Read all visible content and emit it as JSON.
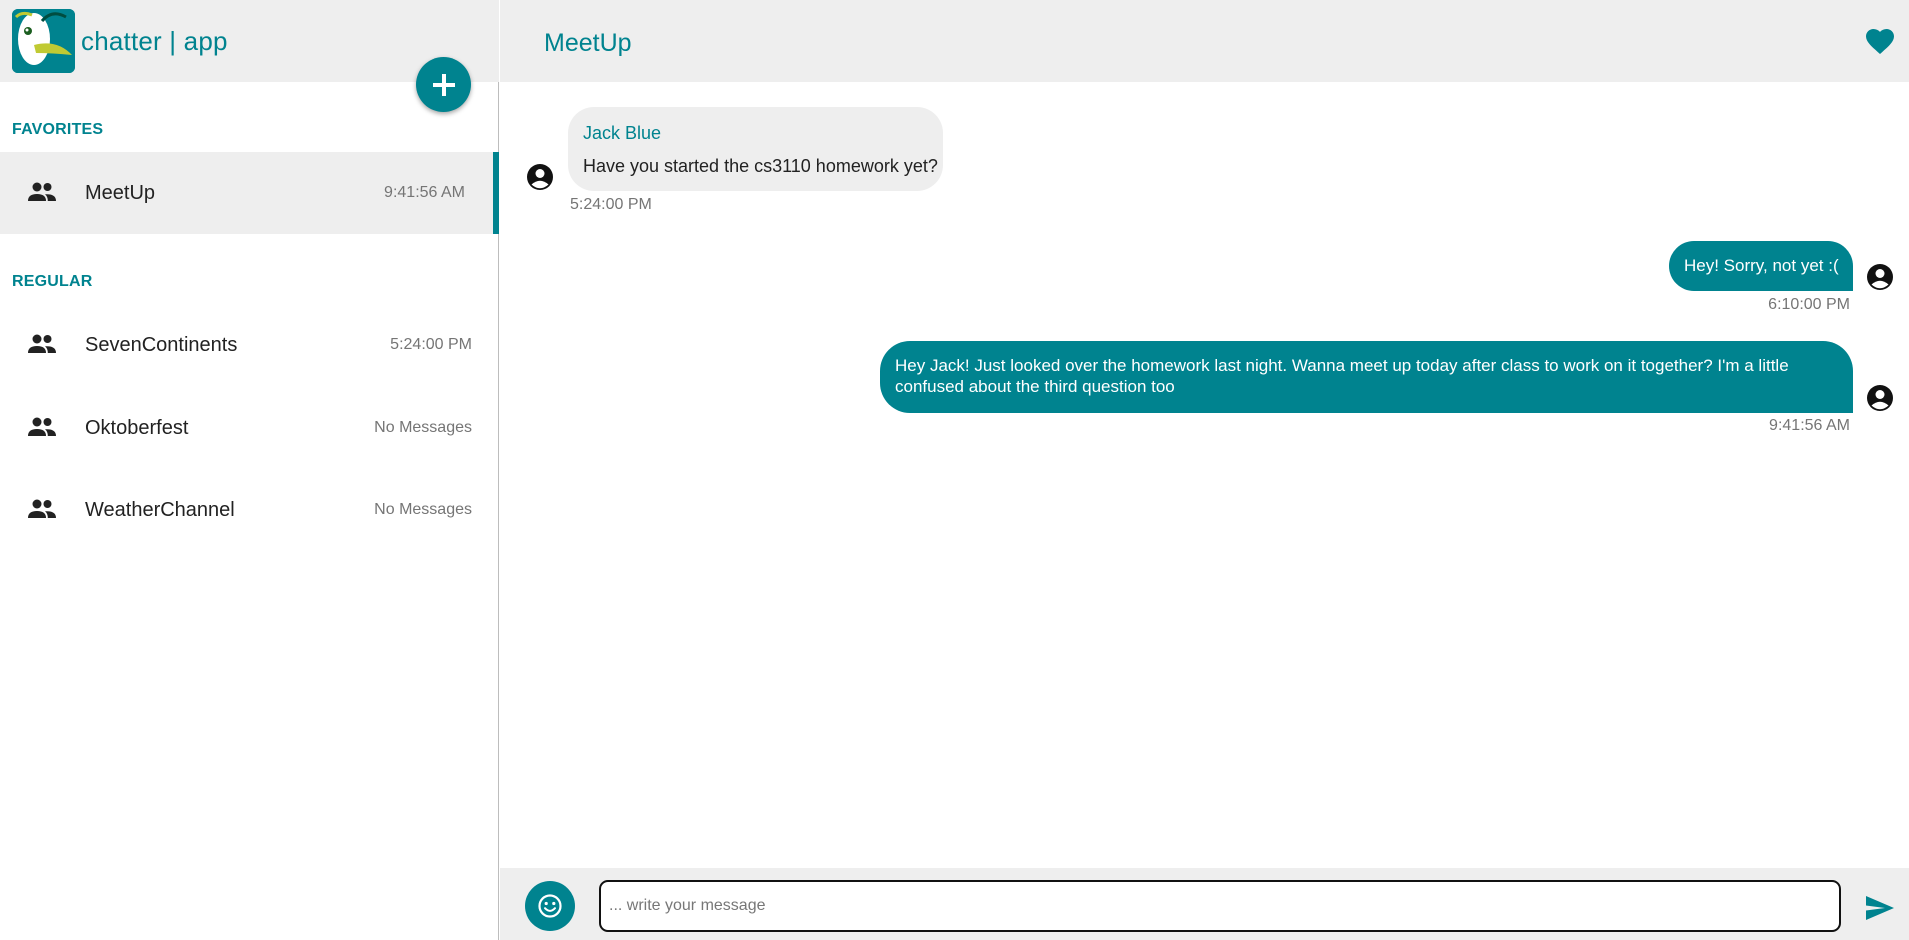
{
  "app": {
    "title": "chatter | app"
  },
  "colors": {
    "accent": "#00838f",
    "panel_bg": "#eeeeee",
    "muted_text": "#757575"
  },
  "sidebar": {
    "add_button_icon": "plus-icon",
    "sections": {
      "favorites_label": "FAVORITES",
      "regular_label": "REGULAR"
    },
    "favorites": [
      {
        "name": "MeetUp",
        "time": "9:41:56 AM",
        "icon": "group-icon",
        "active": true
      }
    ],
    "regular": [
      {
        "name": "SevenContinents",
        "time": "5:24:00 PM",
        "icon": "group-icon"
      },
      {
        "name": "Oktoberfest",
        "time": "No Messages",
        "icon": "group-icon"
      },
      {
        "name": "WeatherChannel",
        "time": "No Messages",
        "icon": "group-icon"
      }
    ]
  },
  "chat": {
    "title": "MeetUp",
    "favorite_icon": "heart-icon",
    "messages": [
      {
        "direction": "incoming",
        "sender": "Jack Blue",
        "text": "Have you started the cs3110 homework yet?",
        "time": "5:24:00 PM"
      },
      {
        "direction": "outgoing",
        "text": "Hey! Sorry, not yet :(",
        "time": "6:10:00 PM"
      },
      {
        "direction": "outgoing",
        "text": "Hey Jack! Just looked over the homework last night. Wanna meet up today after class to work on it together? I'm a little confused about the third question too",
        "time": "9:41:56 AM"
      }
    ]
  },
  "composer": {
    "placeholder": "... write your message",
    "value": "",
    "emoji_icon": "smiley-icon",
    "send_icon": "send-icon"
  }
}
